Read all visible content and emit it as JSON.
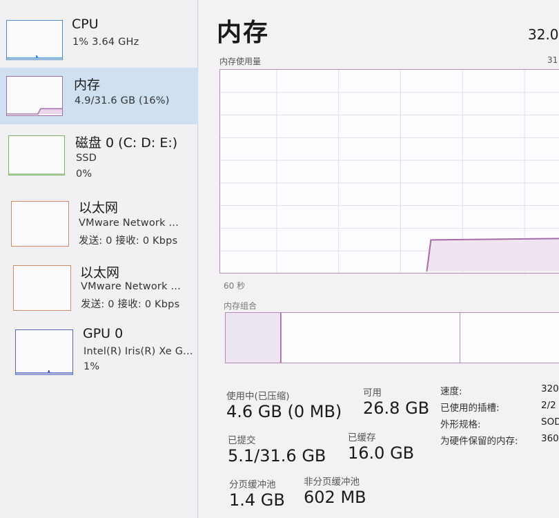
{
  "sidebar": {
    "items": [
      {
        "title": "CPU",
        "line1": "1% 3.64 GHz",
        "line2": ""
      },
      {
        "title": "内存",
        "line1": "4.9/31.6 GB (16%)",
        "line2": ""
      },
      {
        "title": "磁盘 0 (C: D: E:)",
        "line1": "SSD",
        "line2": "0%"
      },
      {
        "title": "以太网",
        "line1": "VMware Network ...",
        "line2": "发送: 0 接收: 0 Kbps"
      },
      {
        "title": "以太网",
        "line1": "VMware Network ...",
        "line2": "发送: 0 接收: 0 Kbps"
      },
      {
        "title": "GPU 0",
        "line1": "Intel(R) Iris(R) Xe G...",
        "line2": "1%"
      }
    ]
  },
  "main": {
    "title": "内存",
    "total_capacity": "32.0",
    "graph_label": "内存使用量",
    "graph_max": "31",
    "time_label": "60 秒",
    "composition_label": "内存组合",
    "stats": {
      "in_use_label": "使用中(已压缩)",
      "in_use_value": "4.6 GB (0 MB)",
      "available_label": "可用",
      "available_value": "26.8 GB",
      "committed_label": "已提交",
      "committed_value": "5.1/31.6 GB",
      "cached_label": "已缓存",
      "cached_value": "16.0 GB",
      "paged_pool_label": "分页缓冲池",
      "paged_pool_value": "1.4 GB",
      "nonpaged_pool_label": "非分页缓冲池",
      "nonpaged_pool_value": "602 MB"
    },
    "properties": {
      "speed_label": "速度:",
      "speed_value": "320",
      "slots_label": "已使用的插槽:",
      "slots_value": "2/2",
      "form_factor_label": "外形规格:",
      "form_factor_value": "SOD",
      "reserved_label": "为硬件保留的内存:",
      "reserved_value": "360"
    }
  },
  "colors": {
    "memory_accent": "#a86aa8",
    "cpu_accent": "#2a7fc8",
    "disk_accent": "#6aa84f",
    "network_accent": "#c87a50",
    "gpu_accent": "#3a4fb8",
    "selected_bg": "#cfe0f0"
  }
}
